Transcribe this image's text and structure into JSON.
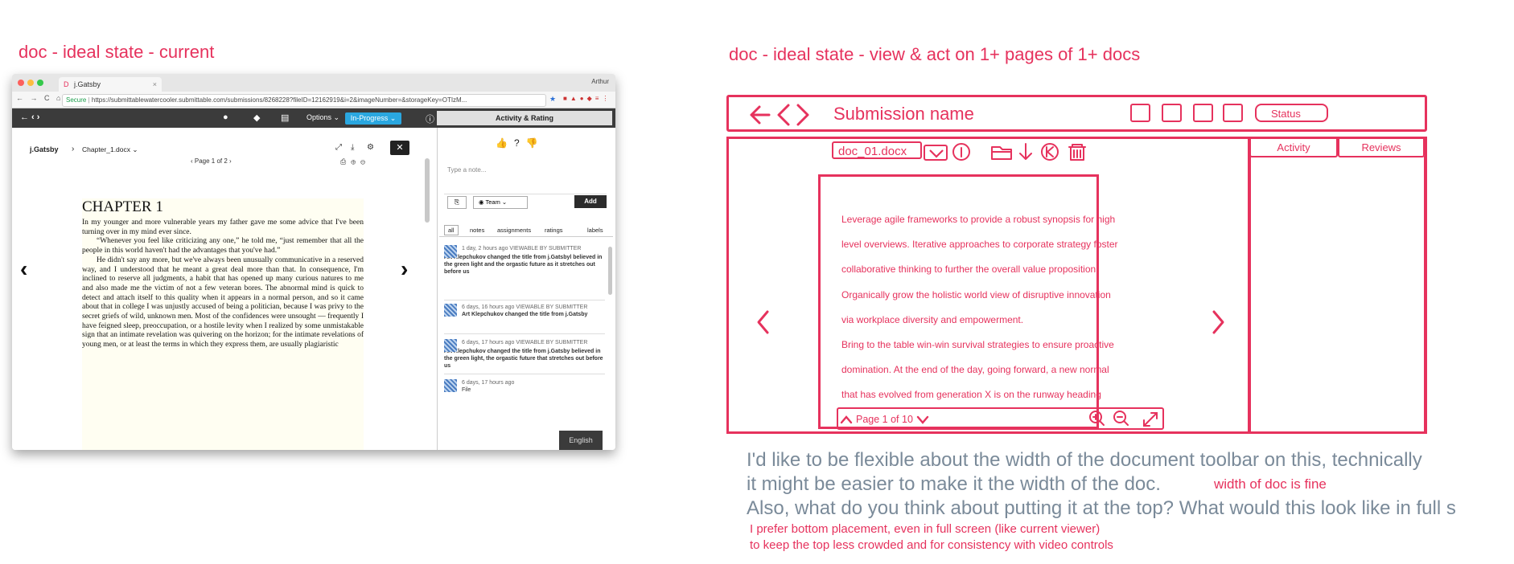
{
  "left_title": "doc - ideal state - current",
  "right_title": "doc - ideal state - view & act on 1+ pages of 1+ docs",
  "browser": {
    "tab_title": "j.Gatsby",
    "user": "Arthur",
    "secure_label": "Secure",
    "url": "https://submittablewatercooler.submittable.com/submissions/8268228?fileID=12162919&i=2&imageNumber=&storageKey=OTIzM..."
  },
  "appbar": {
    "nav": "← ‹ ›",
    "options_label": "Options ⌄",
    "status_label": "In-Progress ⌄",
    "panel_label": "Activity & Rating"
  },
  "viewer": {
    "breadcrumb_root": "j.Gatsby",
    "breadcrumb_sep": "›",
    "breadcrumb_file": "Chapter_1.docx ⌄",
    "page_indicator": "‹  Page 1 of 2  ›",
    "chapter_heading": "CHAPTER 1",
    "paragraphs": [
      "In my younger and more vulnerable years my father gave me some advice that I've been turning over in my mind ever since.",
      "“Whenever you feel like criticizing any one,” he told me, “just remember that all the people in this world haven't had the advantages that you've had.”",
      "He didn't say any more, but we've always been unusually communicative in a reserved way, and I understood that he meant a great deal more than that. In consequence, I'm inclined to reserve all judgments, a habit that has opened up many curious natures to me and also made me the victim of not a few veteran bores. The abnormal mind is quick to detect and attach itself to this quality when it appears in a normal person, and so it came about that in college I was unjustly accused of being a politician, because I was privy to the secret griefs of wild, unknown men. Most of the confidences were unsought — frequently I have feigned sleep, preoccupation, or a hostile levity when I realized by some unmistakable sign that an intimate revelation was quivering on the horizon; for the intimate revelations of young men, or at least the terms in which they express them, are usually plagiaristic"
    ]
  },
  "side": {
    "note_placeholder": "Type a note...",
    "team_label": "Team",
    "add_label": "Add",
    "filters": [
      "all",
      "notes",
      "assignments",
      "ratings",
      "labels"
    ],
    "feed": [
      {
        "meta": "1 day, 2 hours ago  VIEWABLE BY SUBMITTER",
        "body": "Art Klepchukov changed the title from j.Gatsbyl believed in the green light and the orgastic future as it stretches out before us"
      },
      {
        "meta": "6 days, 16 hours ago  VIEWABLE BY SUBMITTER",
        "body": "Art Klepchukov changed the title from j.Gatsby"
      },
      {
        "meta": "6 days, 17 hours ago  VIEWABLE BY SUBMITTER",
        "body": "Art Klepchukov changed the title from j.Gatsby believed in the green light, the orgastic future that stretches out before us"
      },
      {
        "meta": "6 days, 17 hours ago",
        "body": "File"
      }
    ],
    "language_label": "English"
  },
  "wireframe": {
    "submission_name": "Submission name",
    "status_label": "Status",
    "doc_name": "doc_01.docx",
    "activity_tab": "Activity",
    "reviews_tab": "Reviews",
    "doc_lines": [
      "Leverage agile frameworks to provide a robust synopsis for high",
      "level overviews. Iterative approaches to corporate strategy foster",
      "collaborative thinking to further the overall value proposition.",
      "Organically grow the holistic world view of disruptive innovation",
      "via workplace diversity and empowerment.",
      "Bring to the table win-win survival strategies to ensure proactive",
      "domination. At the end of the day, going forward, a new normal",
      "that has evolved from generation X is on the runway heading"
    ],
    "page_indicator": "Page 1 of 10"
  },
  "notes": {
    "gray_1": "I'd like to be flexible about the width of the document toolbar on this, technically",
    "gray_2": "it might be easier to make it the width of the doc.",
    "red_inline": "width of doc is fine",
    "gray_3": "Also, what do you think about putting it at the top? What would this look like in full s",
    "red_1": "I prefer bottom placement, even in full screen (like current viewer)",
    "red_2": "to keep the top less crowded and for consistency with video controls"
  },
  "colors": {
    "accent": "#e6325d",
    "note_gray": "#7a8a99",
    "appbar": "#3b3b3b",
    "status_blue": "#2aa7e0"
  }
}
